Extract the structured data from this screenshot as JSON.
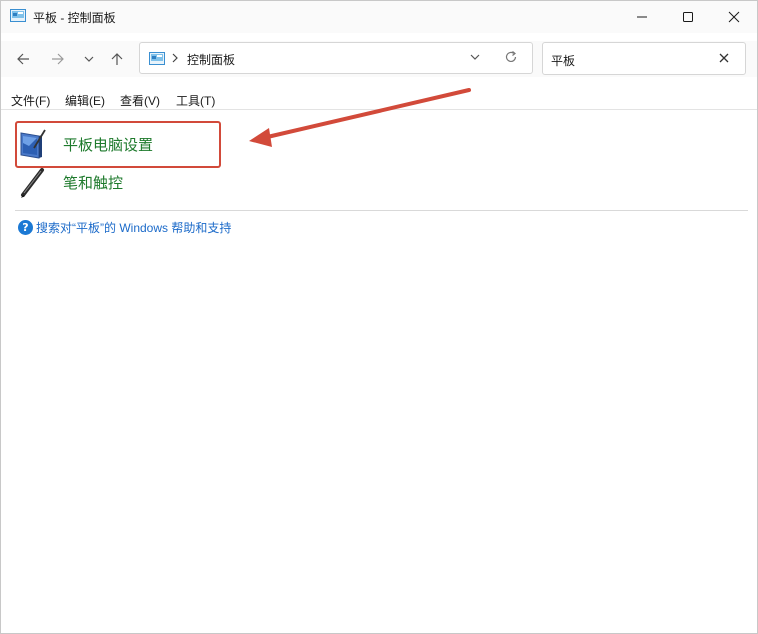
{
  "window": {
    "title": "平板 - 控制面板"
  },
  "address_bar": {
    "path": "控制面板"
  },
  "search": {
    "query": "平板"
  },
  "menu": [
    {
      "label": "文件(F)"
    },
    {
      "label": "编辑(E)"
    },
    {
      "label": "查看(V)"
    },
    {
      "label": "工具(T)"
    }
  ],
  "results": [
    {
      "label": "平板电脑设置",
      "icon": "tablet-pc-icon"
    },
    {
      "label": "笔和触控",
      "icon": "pen-icon"
    }
  ],
  "help_link": {
    "label": "搜索对“平板”的 Windows 帮助和支持"
  },
  "colors": {
    "link": "#1b6ac9",
    "result_text": "#1e7a2c",
    "annotation": "#d24a3a"
  }
}
